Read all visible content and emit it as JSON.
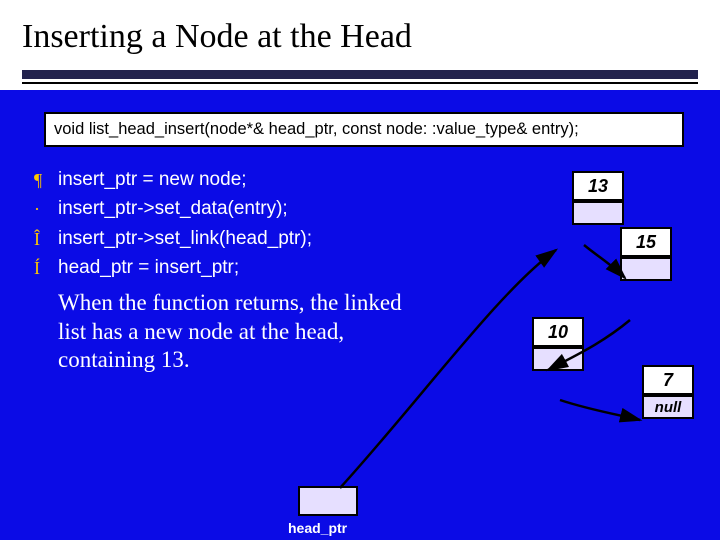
{
  "title": "Inserting a Node at the Head",
  "signature": "void list_head_insert(node*& head_ptr, const node: :value_type& entry);",
  "bullets": {
    "b1": "¶",
    "b2": "·",
    "b3": "Î",
    "b4": "Í"
  },
  "steps": {
    "s1": "insert_ptr = new node;",
    "s2": "insert_ptr->set_data(entry);",
    "s3": "insert_ptr->set_link(head_ptr);",
    "s4": "head_ptr = insert_ptr;"
  },
  "note": "When the function returns, the linked list has a new node at the head, containing 13.",
  "nodes": {
    "n13": "13",
    "n15": "15",
    "n10": "10",
    "n7": "7",
    "null": "null"
  },
  "head_label": "head_ptr"
}
